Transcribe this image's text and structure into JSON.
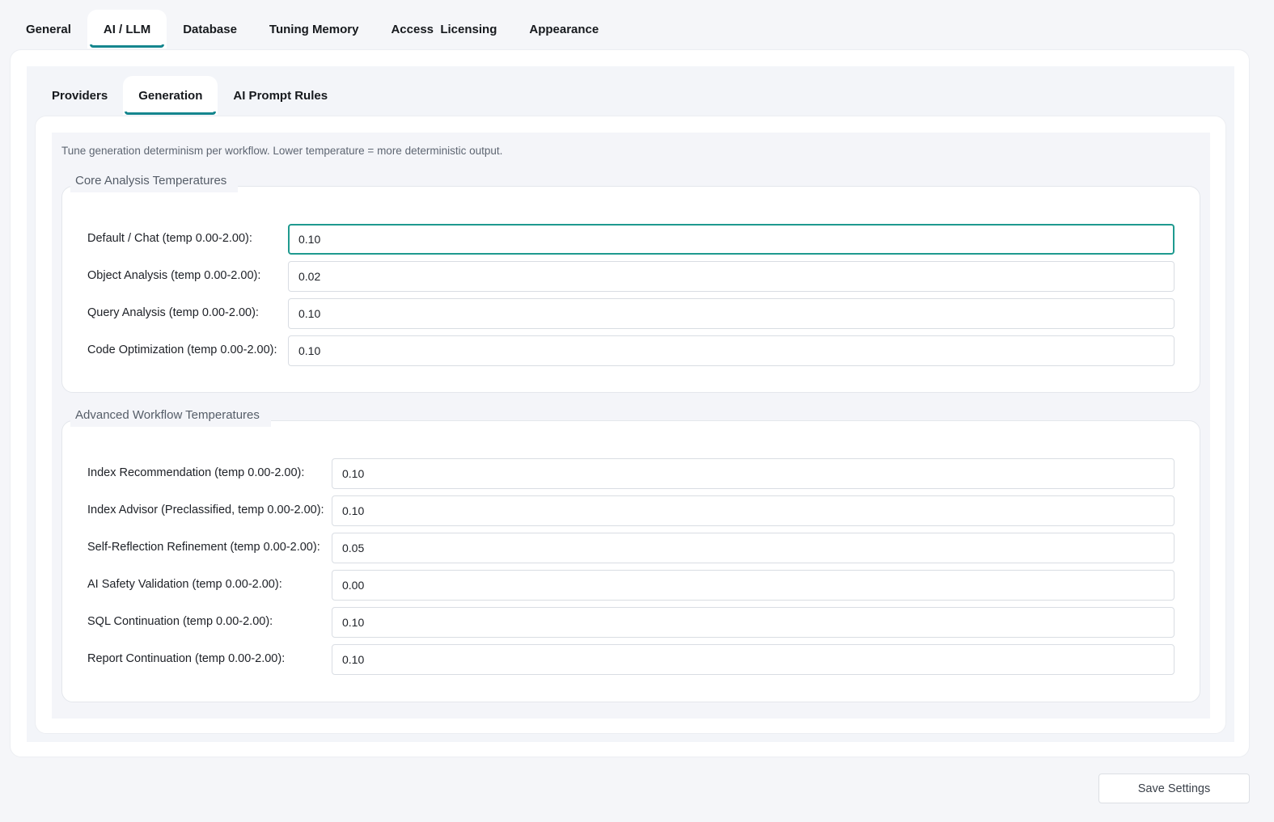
{
  "top_tabs": [
    {
      "label": "General",
      "active": false
    },
    {
      "label": "AI / LLM",
      "active": true
    },
    {
      "label": "Database",
      "active": false
    },
    {
      "label": "Tuning Memory",
      "active": false
    },
    {
      "label": "Access  Licensing",
      "active": false
    },
    {
      "label": "Appearance",
      "active": false
    }
  ],
  "sub_tabs": [
    {
      "label": "Providers",
      "active": false
    },
    {
      "label": "Generation",
      "active": true
    },
    {
      "label": "AI Prompt Rules",
      "active": false
    }
  ],
  "hint": "Tune generation determinism per workflow. Lower temperature = more deterministic output.",
  "core_group": {
    "title": "Core Analysis Temperatures",
    "fields": [
      {
        "label": "Default / Chat (temp 0.00-2.00):",
        "value": "0.10",
        "focused": true
      },
      {
        "label": "Object Analysis (temp 0.00-2.00):",
        "value": "0.02"
      },
      {
        "label": "Query Analysis (temp 0.00-2.00):",
        "value": "0.10"
      },
      {
        "label": "Code Optimization (temp 0.00-2.00):",
        "value": "0.10"
      }
    ]
  },
  "advanced_group": {
    "title": "Advanced Workflow Temperatures",
    "fields": [
      {
        "label": "Index Recommendation (temp 0.00-2.00):",
        "value": "0.10"
      },
      {
        "label": "Index Advisor (Preclassified, temp 0.00-2.00):",
        "value": "0.10"
      },
      {
        "label": "Self-Reflection Refinement (temp 0.00-2.00):",
        "value": "0.05"
      },
      {
        "label": "AI Safety Validation (temp 0.00-2.00):",
        "value": "0.00"
      },
      {
        "label": "SQL Continuation (temp 0.00-2.00):",
        "value": "0.10"
      },
      {
        "label": "Report Continuation (temp 0.00-2.00):",
        "value": "0.10"
      }
    ]
  },
  "save_button": "Save Settings",
  "colors": {
    "accent": "#15868e",
    "focus_border": "#1f9a8f"
  }
}
